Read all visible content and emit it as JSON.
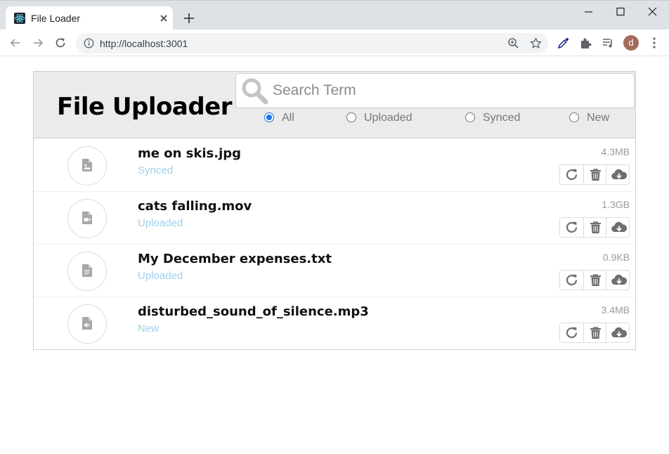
{
  "browser": {
    "tab_title": "File Loader",
    "url": "http://localhost:3001",
    "profile_initial": "d"
  },
  "app": {
    "title": "File Uploader",
    "search_placeholder": "Search Term",
    "filters": [
      {
        "label": "All",
        "checked": true
      },
      {
        "label": "Uploaded",
        "checked": false
      },
      {
        "label": "Synced",
        "checked": false
      },
      {
        "label": "New",
        "checked": false
      }
    ],
    "files": [
      {
        "name": "me on skis.jpg",
        "status": "Synced",
        "size": "4.3MB",
        "icon": "image-file-icon"
      },
      {
        "name": "cats falling.mov",
        "status": "Uploaded",
        "size": "1.3GB",
        "icon": "video-file-icon"
      },
      {
        "name": "My December expenses.txt",
        "status": "Uploaded",
        "size": "0.9KB",
        "icon": "text-file-icon"
      },
      {
        "name": "disturbed_sound_of_silence.mp3",
        "status": "New",
        "size": "3.4MB",
        "icon": "audio-file-icon"
      }
    ]
  },
  "colors": {
    "status": "#9fd0ea",
    "radio_accent": "#1a73e8",
    "header_bg": "#ebebeb",
    "icon_gray": "#7a7a7a"
  }
}
